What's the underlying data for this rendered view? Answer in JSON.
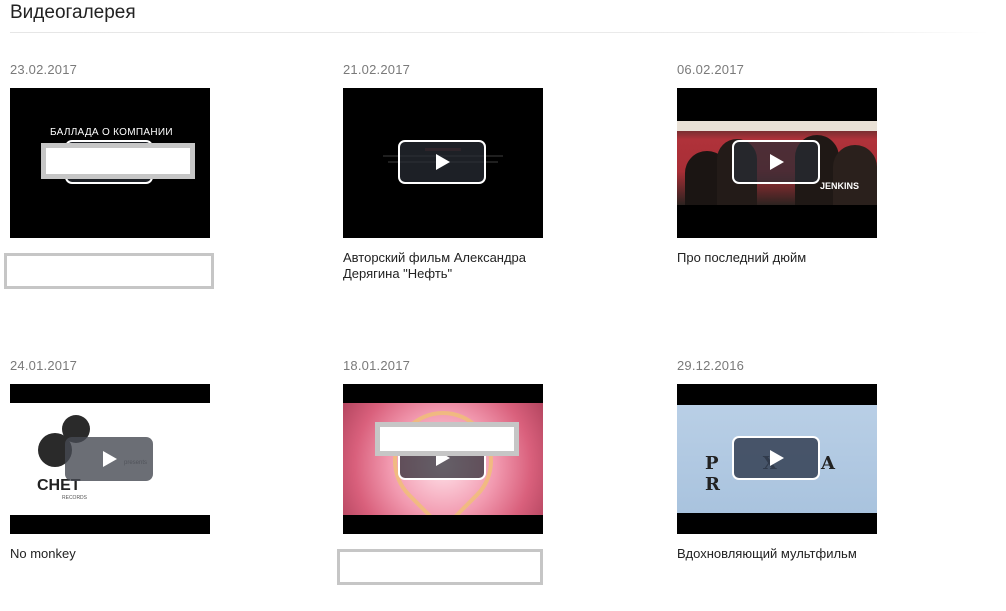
{
  "page": {
    "title": "Видеогалерея"
  },
  "videos": [
    {
      "date": "23.02.2017",
      "caption": "",
      "thumb_text": "БАЛЛАДА О КОМПАНИИ"
    },
    {
      "date": "21.02.2017",
      "caption": "Авторский фильм Александра Дерягина \"Нефть\""
    },
    {
      "date": "06.02.2017",
      "caption": "Про последний дюйм",
      "thumb_text": "JENKINS"
    },
    {
      "date": "24.01.2017",
      "caption": "No monkey",
      "thumb_text": "CHET",
      "thumb_text2": "RECORDS",
      "thumb_text3": "presents"
    },
    {
      "date": "18.01.2017",
      "caption": ""
    },
    {
      "date": "29.12.2016",
      "caption": "Вдохновляющий мультфильм",
      "thumb_text": "P X A R"
    }
  ],
  "icons": {
    "play": "play-icon"
  }
}
